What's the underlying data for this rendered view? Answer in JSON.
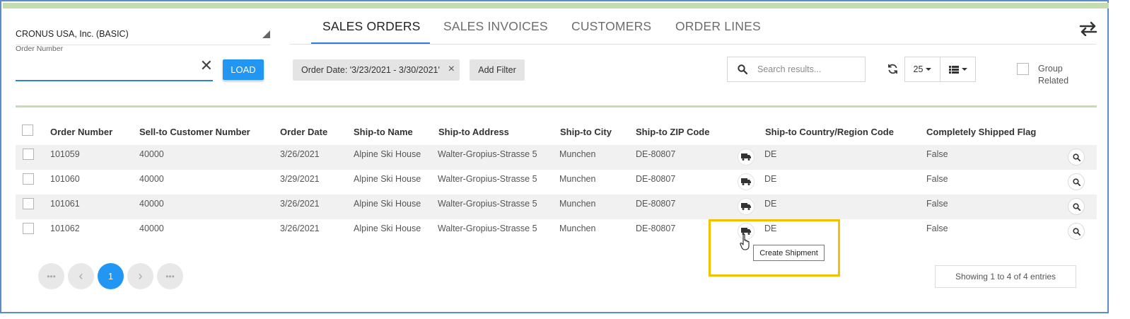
{
  "left_panel": {
    "company": "CRONUS USA, Inc. (BASIC)",
    "order_number_label": "Order Number",
    "order_number_value": "",
    "load_label": "LOAD"
  },
  "tabs": [
    {
      "label": "SALES ORDERS",
      "active": true
    },
    {
      "label": "SALES INVOICES",
      "active": false
    },
    {
      "label": "CUSTOMERS",
      "active": false
    },
    {
      "label": "ORDER LINES",
      "active": false
    }
  ],
  "toolbar": {
    "filter_chip": "Order Date: '3/23/2021 - 3/30/2021'",
    "add_filter": "Add Filter",
    "search_placeholder": "Search results...",
    "page_size": "25",
    "group_related": "Group Related"
  },
  "table": {
    "columns": [
      "Order Number",
      "Sell-to Customer Number",
      "Order Date",
      "Ship-to Name",
      "Ship-to Address",
      "Ship-to City",
      "Ship-to ZIP Code",
      "Ship-to Country/Region Code",
      "Completely Shipped Flag"
    ],
    "rows": [
      [
        "101059",
        "40000",
        "3/26/2021",
        "Alpine Ski House",
        "Walter-Gropius-Strasse 5",
        "Munchen",
        "DE-80807",
        "DE",
        "False"
      ],
      [
        "101060",
        "40000",
        "3/29/2021",
        "Alpine Ski House",
        "Walter-Gropius-Strasse 5",
        "Munchen",
        "DE-80807",
        "DE",
        "False"
      ],
      [
        "101061",
        "40000",
        "3/26/2021",
        "Alpine Ski House",
        "Walter-Gropius-Strasse 5",
        "Munchen",
        "DE-80807",
        "DE",
        "False"
      ],
      [
        "101062",
        "40000",
        "3/26/2021",
        "Alpine Ski House",
        "Walter-Gropius-Strasse 5",
        "Munchen",
        "DE-80807",
        "DE",
        "False"
      ]
    ]
  },
  "tooltip": "Create Shipment",
  "pagination": {
    "first": "•••",
    "prev": "‹",
    "current": "1",
    "next": "›",
    "last": "•••",
    "entries": "Showing 1 to 4 of 4 entries"
  },
  "icons": {
    "shipment": "truck-icon",
    "row_action": "search-icon",
    "swap": "swap-arrows-icon",
    "refresh": "refresh-icon",
    "view": "list-view-icon"
  },
  "colors": {
    "accent": "#2196f3",
    "tab_underline": "#2f7fd6",
    "highlight": "#f2c100",
    "divider": "#c5dcb0"
  }
}
